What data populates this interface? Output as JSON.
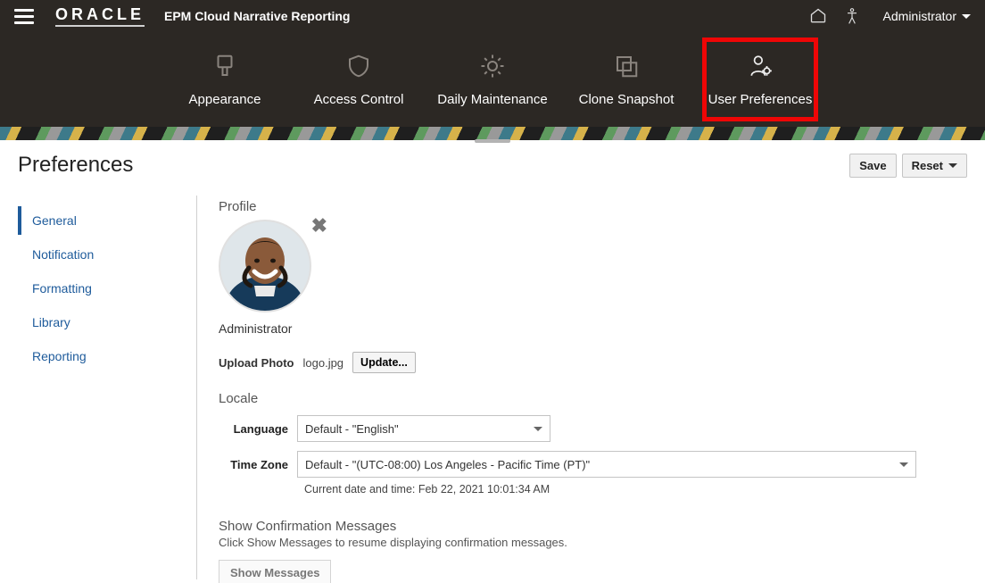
{
  "header": {
    "logo_text": "ORACLE",
    "product": "EPM Cloud Narrative Reporting",
    "user_label": "Administrator"
  },
  "nav": {
    "items": [
      {
        "label": "Appearance"
      },
      {
        "label": "Access Control"
      },
      {
        "label": "Daily Maintenance"
      },
      {
        "label": "Clone Snapshot"
      },
      {
        "label": "User Preferences"
      }
    ]
  },
  "page": {
    "title": "Preferences",
    "save_label": "Save",
    "reset_label": "Reset"
  },
  "sidebar": {
    "items": [
      {
        "label": "General",
        "active": true
      },
      {
        "label": "Notification"
      },
      {
        "label": "Formatting"
      },
      {
        "label": "Library"
      },
      {
        "label": "Reporting"
      }
    ]
  },
  "profile": {
    "section_title": "Profile",
    "user_name": "Administrator",
    "upload_label": "Upload Photo",
    "filename": "logo.jpg",
    "update_button": "Update..."
  },
  "locale": {
    "section_title": "Locale",
    "language_label": "Language",
    "language_value": "Default - \"English\"",
    "timezone_label": "Time Zone",
    "timezone_value": "Default - \"(UTC-08:00) Los Angeles - Pacific Time (PT)\"",
    "datetime_hint": "Current date and time: Feb 22, 2021 10:01:34 AM"
  },
  "confirm": {
    "title": "Show Confirmation Messages",
    "desc": "Click Show Messages to resume displaying confirmation messages.",
    "button": "Show Messages"
  }
}
